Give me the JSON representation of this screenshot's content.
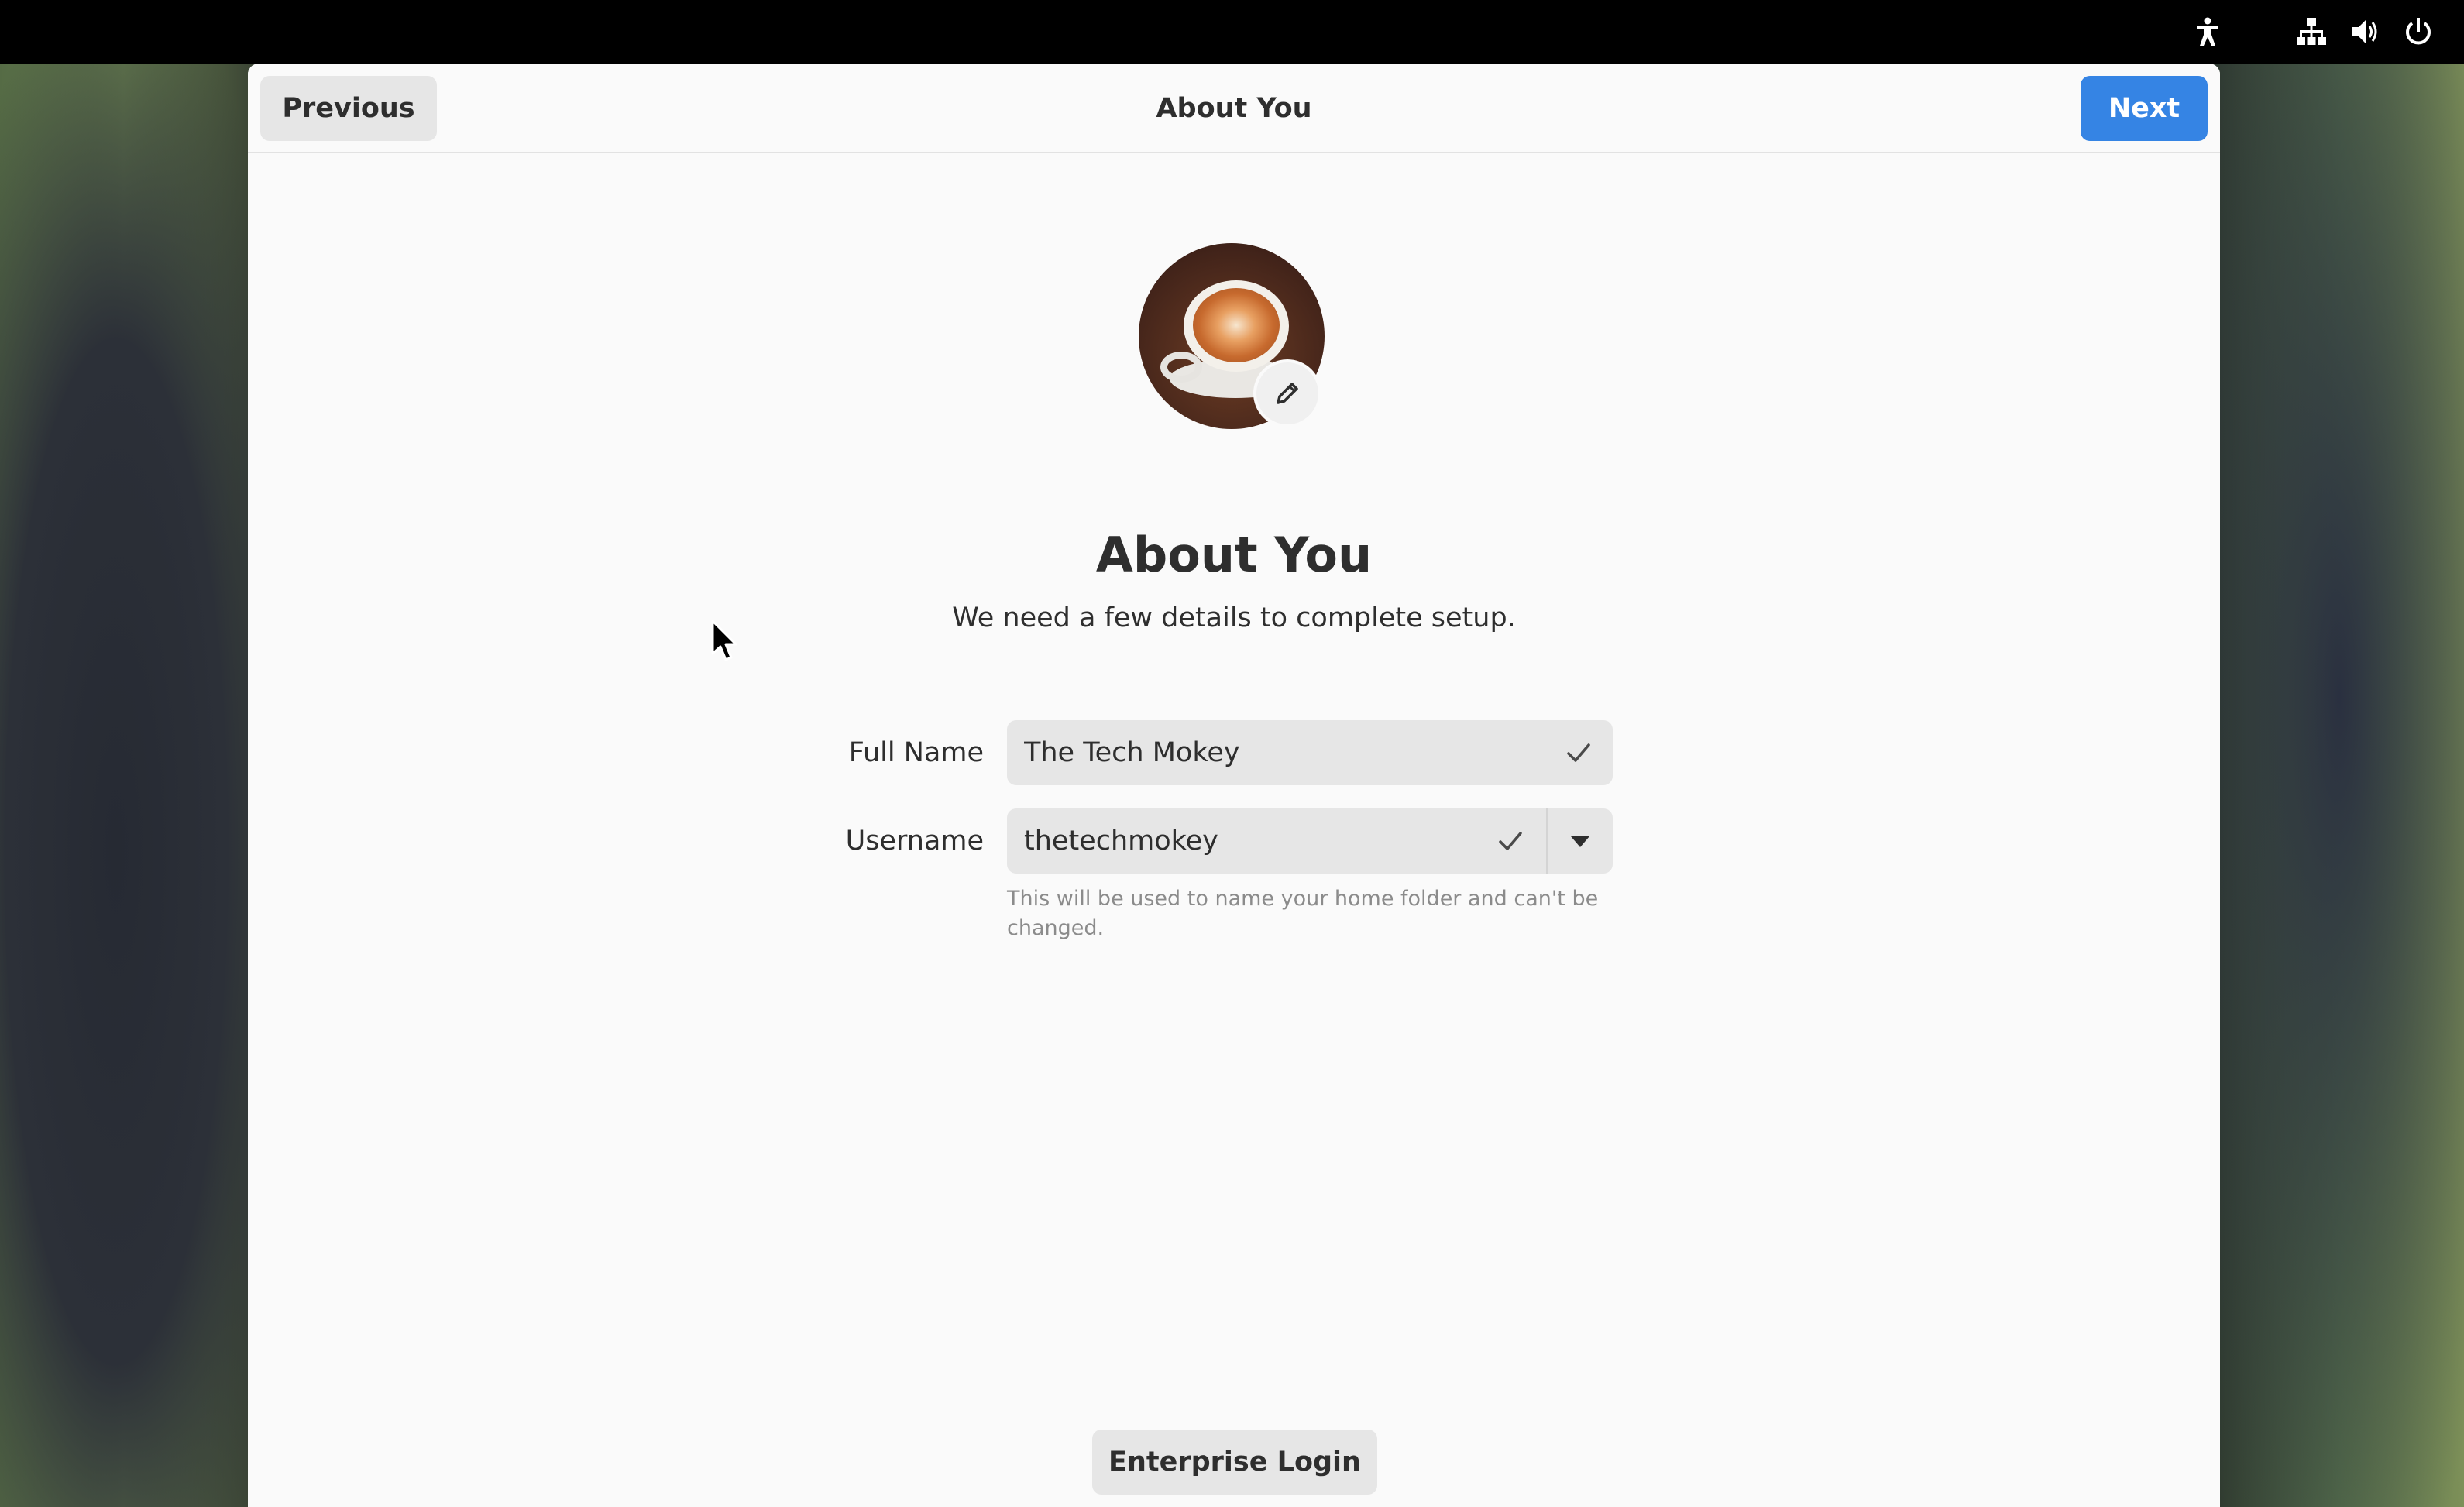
{
  "topbar": {
    "icons": [
      "accessibility-icon",
      "network-icon",
      "volume-icon",
      "power-icon"
    ]
  },
  "header": {
    "previous_label": "Previous",
    "title": "About You",
    "next_label": "Next"
  },
  "main": {
    "avatar": {
      "description_icon": "coffee-avatar",
      "edit_icon": "pencil-icon"
    },
    "title": "About You",
    "subtitle": "We need a few details to complete setup.",
    "full_name": {
      "label": "Full Name",
      "value": "The Tech Mokey",
      "status_icon": "check-icon"
    },
    "username": {
      "label": "Username",
      "value": "thetechmokey",
      "status_icon": "check-icon",
      "dropdown_icon": "chevron-down-icon",
      "hint": "This will be used to name your home folder and can't be changed."
    },
    "enterprise_login_label": "Enterprise Login"
  },
  "colors": {
    "accent": "#3584e4",
    "window_bg": "#fafafa",
    "button_bg": "#e6e6e6",
    "topbar_bg": "#000000"
  }
}
